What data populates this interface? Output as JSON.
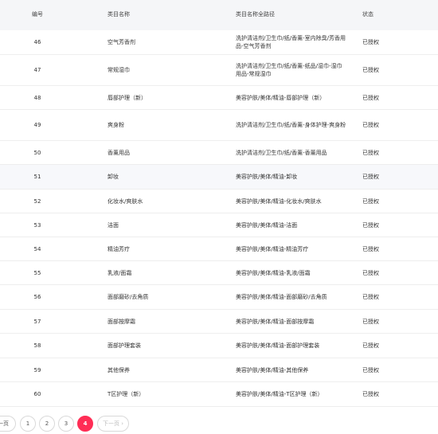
{
  "table": {
    "headers": {
      "id": "编号",
      "name": "类目名称",
      "path": "类目名称全路径",
      "status": "状态"
    },
    "rows": [
      {
        "id": "46",
        "name": "空气芳香剂",
        "path": "洗护清洁剂/卫生巾/纸/香薰-室内除臭/芳香用品-空气芳香剂",
        "status": "已授权"
      },
      {
        "id": "47",
        "name": "常规湿巾",
        "path": "洗护清洁剂/卫生巾/纸/香薰-纸品/湿巾-湿巾用品-常规湿巾",
        "status": "已授权"
      },
      {
        "id": "48",
        "name": "唇部护理（新）",
        "path": "美容护肤/美体/精油-唇部护理（新）",
        "status": "已授权"
      },
      {
        "id": "49",
        "name": "爽身粉",
        "path": "洗护清洁剂/卫生巾/纸/香薰-身体护理-爽身粉",
        "status": "已授权"
      },
      {
        "id": "50",
        "name": "香薰用品",
        "path": "洗护清洁剂/卫生巾/纸/香薰-香薰用品",
        "status": "已授权"
      },
      {
        "id": "51",
        "name": "卸妆",
        "path": "美容护肤/美体/精油-卸妆",
        "status": "已授权"
      },
      {
        "id": "52",
        "name": "化妆水/爽肤水",
        "path": "美容护肤/美体/精油-化妆水/爽肤水",
        "status": "已授权"
      },
      {
        "id": "53",
        "name": "洁面",
        "path": "美容护肤/美体/精油-洁面",
        "status": "已授权"
      },
      {
        "id": "54",
        "name": "精油芳疗",
        "path": "美容护肤/美体/精油-精油芳疗",
        "status": "已授权"
      },
      {
        "id": "55",
        "name": "乳液/面霜",
        "path": "美容护肤/美体/精油-乳液/面霜",
        "status": "已授权"
      },
      {
        "id": "56",
        "name": "面部磨砂/去角质",
        "path": "美容护肤/美体/精油-面部磨砂/去角质",
        "status": "已授权"
      },
      {
        "id": "57",
        "name": "面部按摩霜",
        "path": "美容护肤/美体/精油-面部按摩霜",
        "status": "已授权"
      },
      {
        "id": "58",
        "name": "面部护理套装",
        "path": "美容护肤/美体/精油-面部护理套装",
        "status": "已授权"
      },
      {
        "id": "59",
        "name": "其他保养",
        "path": "美容护肤/美体/精油-其他保养",
        "status": "已授权"
      },
      {
        "id": "60",
        "name": "T区护理（新）",
        "path": "美容护肤/美体/精油-T区护理（新）",
        "status": "已授权"
      }
    ]
  },
  "pagination": {
    "prev_label": "一页",
    "pages": [
      "1",
      "2",
      "3",
      "4"
    ],
    "active_page": "4",
    "next_label": "下一页 ›"
  },
  "colors": {
    "accent": "#ff2d55",
    "header_bg": "#f5f6f8",
    "highlight_row": "#f7f8fb"
  }
}
